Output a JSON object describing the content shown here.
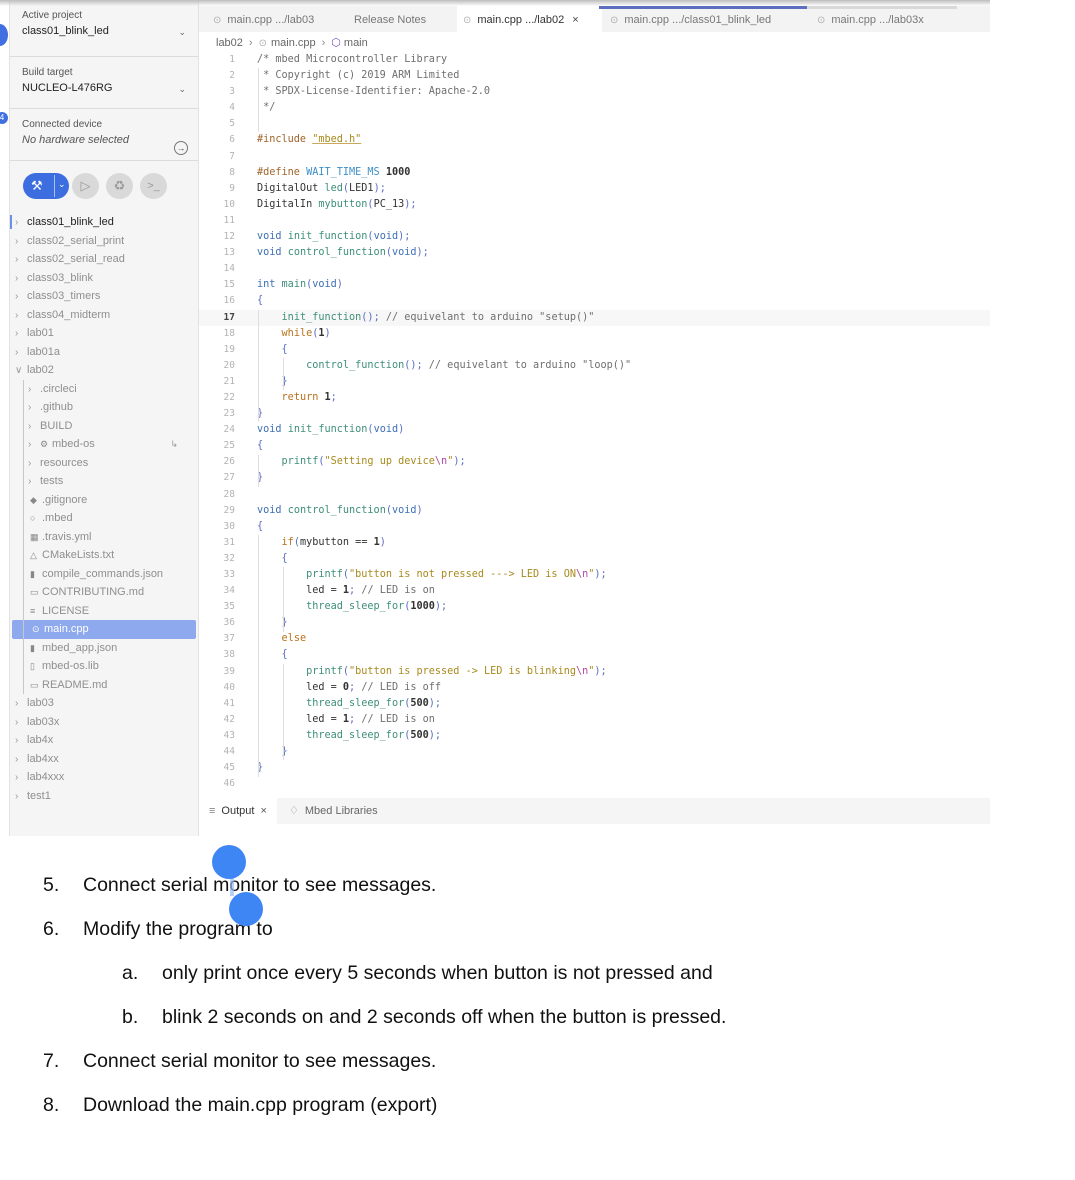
{
  "sidebar": {
    "active_project": {
      "label": "Active project",
      "value": "class01_blink_led"
    },
    "build_target": {
      "label": "Build target",
      "value": "NUCLEO-L476RG"
    },
    "connected_device": {
      "label": "Connected device",
      "value": "No hardware selected"
    },
    "strip_badge": "4",
    "toolbar": {
      "build": "hammer-icon",
      "run": "play-icon",
      "debug": "bug-icon",
      "terminal": "terminal-icon"
    },
    "tree": [
      {
        "label": "class01_blink_led",
        "level": 0,
        "kind": "folder",
        "active": true
      },
      {
        "label": "class02_serial_print",
        "level": 0,
        "kind": "folder"
      },
      {
        "label": "class02_serial_read",
        "level": 0,
        "kind": "folder"
      },
      {
        "label": "class03_blink",
        "level": 0,
        "kind": "folder"
      },
      {
        "label": "class03_timers",
        "level": 0,
        "kind": "folder"
      },
      {
        "label": "class04_midterm",
        "level": 0,
        "kind": "folder"
      },
      {
        "label": "lab01",
        "level": 0,
        "kind": "folder"
      },
      {
        "label": "lab01a",
        "level": 0,
        "kind": "folder"
      },
      {
        "label": "lab02",
        "level": 0,
        "kind": "folder",
        "expanded": true
      },
      {
        "label": ".circleci",
        "level": 1,
        "kind": "folder"
      },
      {
        "label": ".github",
        "level": 1,
        "kind": "folder"
      },
      {
        "label": "BUILD",
        "level": 1,
        "kind": "folder"
      },
      {
        "label": "mbed-os",
        "level": 1,
        "kind": "folder",
        "icon": "gear-icon",
        "linked": true
      },
      {
        "label": "resources",
        "level": 1,
        "kind": "folder"
      },
      {
        "label": "tests",
        "level": 1,
        "kind": "folder"
      },
      {
        "label": ".gitignore",
        "level": 1,
        "kind": "file",
        "icon": "git-icon"
      },
      {
        "label": ".mbed",
        "level": 1,
        "kind": "file",
        "icon": "circle-icon"
      },
      {
        "label": ".travis.yml",
        "level": 1,
        "kind": "file",
        "icon": "grid-icon"
      },
      {
        "label": "CMakeLists.txt",
        "level": 1,
        "kind": "file",
        "icon": "triangle-icon"
      },
      {
        "label": "compile_commands.json",
        "level": 1,
        "kind": "file",
        "icon": "json-icon"
      },
      {
        "label": "CONTRIBUTING.md",
        "level": 1,
        "kind": "file",
        "icon": "markdown-icon"
      },
      {
        "label": "LICENSE",
        "level": 1,
        "kind": "file",
        "icon": "license-icon"
      },
      {
        "label": "main.cpp",
        "level": 1,
        "kind": "file",
        "icon": "cpp-icon",
        "selected": true
      },
      {
        "label": "mbed_app.json",
        "level": 1,
        "kind": "file",
        "icon": "json-icon"
      },
      {
        "label": "mbed-os.lib",
        "level": 1,
        "kind": "file",
        "icon": "file-icon"
      },
      {
        "label": "README.md",
        "level": 1,
        "kind": "file",
        "icon": "markdown-icon"
      },
      {
        "label": "lab03",
        "level": 0,
        "kind": "folder"
      },
      {
        "label": "lab03x",
        "level": 0,
        "kind": "folder"
      },
      {
        "label": "lab4x",
        "level": 0,
        "kind": "folder"
      },
      {
        "label": "lab4xx",
        "level": 0,
        "kind": "folder"
      },
      {
        "label": "lab4xxx",
        "level": 0,
        "kind": "folder"
      },
      {
        "label": "test1",
        "level": 0,
        "kind": "folder"
      }
    ]
  },
  "editor": {
    "tabs": [
      {
        "label": "main.cpp .../lab03",
        "cpp": true
      },
      {
        "label": "Release Notes",
        "cpp": false
      },
      {
        "label": "main.cpp .../lab02",
        "cpp": true,
        "active": true,
        "closable": true
      },
      {
        "label": "main.cpp .../class01_blink_led",
        "cpp": true
      },
      {
        "label": "main.cpp .../lab03x",
        "cpp": true
      }
    ],
    "close_glyph": "×",
    "breadcrumb": {
      "folder": "lab02",
      "file": "main.cpp",
      "symbol": "main"
    },
    "current_line": 17,
    "lines": [
      "/* mbed Microcontroller Library",
      " * Copyright (c) 2019 ARM Limited",
      " * SPDX-License-Identifier: Apache-2.0",
      " */",
      "",
      "#include \"mbed.h\"",
      "",
      "#define WAIT_TIME_MS 1000",
      "DigitalOut led(LED1);",
      "DigitalIn mybutton(PC_13);",
      "",
      "void init_function(void);",
      "void control_function(void);",
      "",
      "int main(void)",
      "{",
      "    init_function(); // equivelant to arduino \"setup()\"",
      "    while(1)",
      "    {",
      "        control_function(); // equivelant to arduino \"loop()\"",
      "    }",
      "    return 1;",
      "}",
      "void init_function(void)",
      "{",
      "    printf(\"Setting up device\\n\");",
      "}",
      "",
      "void control_function(void)",
      "{",
      "    if(mybutton == 1)",
      "    {",
      "        printf(\"button is not pressed ---> LED is ON\\n\");",
      "        led = 1; // LED is on",
      "        thread_sleep_for(1000);",
      "    }",
      "    else",
      "    {",
      "        printf(\"button is pressed -> LED is blinking\\n\");",
      "        led = 0; // LED is off",
      "        thread_sleep_for(500);",
      "        led = 1; // LED is on",
      "        thread_sleep_for(500);",
      "    }",
      "}",
      ""
    ],
    "bottom_tabs": [
      {
        "label": "Output",
        "icon": "menu-icon",
        "active": true
      },
      {
        "label": "Mbed Libraries",
        "icon": "library-icon"
      }
    ]
  },
  "document": {
    "items": [
      {
        "num": "5.",
        "text": "Connect serial monitor to see messages."
      },
      {
        "num": "6.",
        "text": "Modify the program to"
      },
      {
        "num": "a.",
        "text": "only print once every 5 seconds when button is not pressed and",
        "sub": true
      },
      {
        "num": "b.",
        "text": "blink 2 seconds on and 2 seconds off when the button is pressed.",
        "sub": true
      },
      {
        "num": "7.",
        "text": "Connect serial monitor to see messages."
      },
      {
        "num": "8.",
        "text": "Download the main.cpp program (export)"
      }
    ]
  },
  "colors": {
    "accent": "#3c6ee0",
    "selection": "#8ea9ee",
    "handle": "#3f86f5"
  }
}
